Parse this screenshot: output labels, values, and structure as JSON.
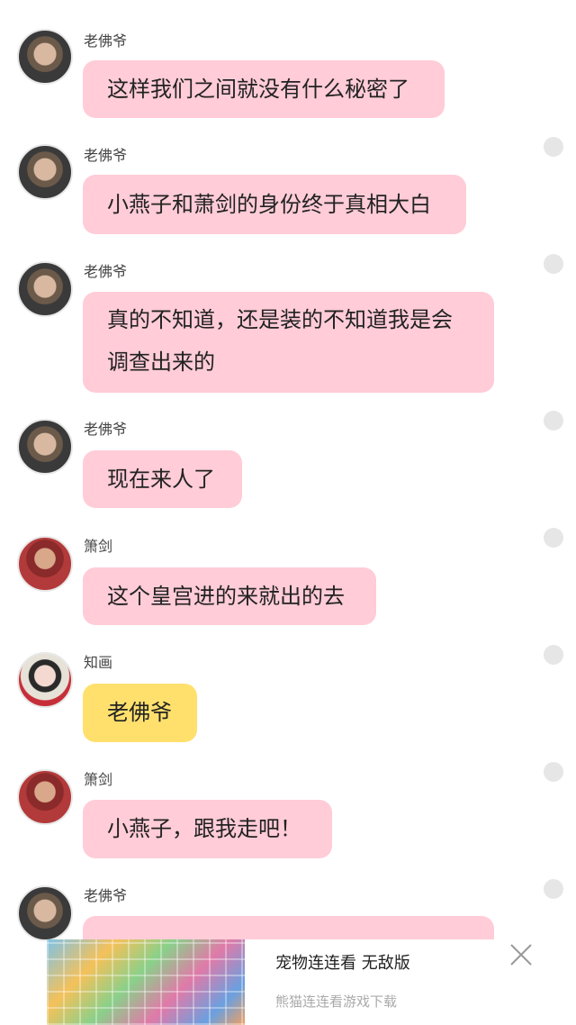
{
  "messages": [
    {
      "sender": "老佛爷",
      "avatar": "laofoye",
      "text": "这样我们之间就没有什么秘密了",
      "color": "pink"
    },
    {
      "sender": "老佛爷",
      "avatar": "laofoye",
      "text": "小燕子和萧剑的身份终于真相大白",
      "color": "pink"
    },
    {
      "sender": "老佛爷",
      "avatar": "laofoye",
      "text": "真的不知道，还是装的不知道我是会\n调查出来的",
      "color": "pink"
    },
    {
      "sender": "老佛爷",
      "avatar": "laofoye",
      "text": "现在来人了",
      "color": "pink"
    },
    {
      "sender": "箫剑",
      "avatar": "xiaojian",
      "text": "这个皇宫进的来就出的去",
      "color": "pink"
    },
    {
      "sender": "知画",
      "avatar": "zhihua",
      "text": "老佛爷",
      "color": "yellow"
    },
    {
      "sender": "箫剑",
      "avatar": "xiaojian",
      "text": "小燕子，跟我走吧！",
      "color": "pink"
    },
    {
      "sender": "老佛爷",
      "avatar": "laofoye",
      "text": "",
      "color": "pink"
    }
  ],
  "ad": {
    "title": "宠物连连看 无敌版",
    "subtitle": "熊猫连连看游戏下载",
    "close_icon": "close-icon"
  },
  "colors": {
    "pink_bubble": "#ffccd8",
    "yellow_bubble": "#ffe06d"
  }
}
